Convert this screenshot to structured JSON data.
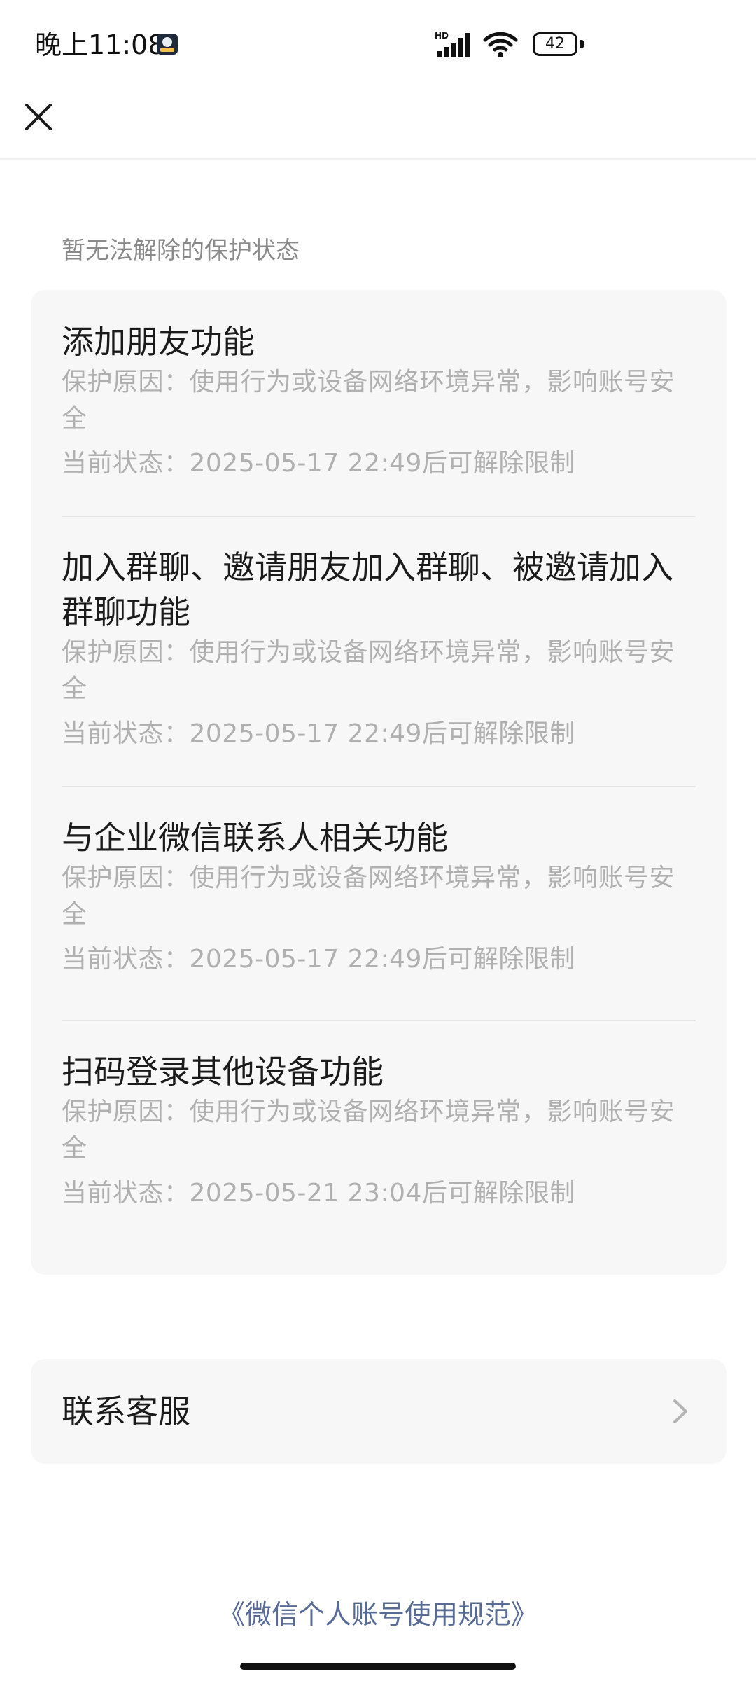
{
  "status_bar": {
    "time": "晚上11:08",
    "network_badge": "HD",
    "battery": "42",
    "battery_level_percent": 42
  },
  "nav": {
    "close_icon": "close-icon"
  },
  "section": {
    "title": "暂无法解除的保护状态"
  },
  "items": [
    {
      "title": "添加朋友功能",
      "reason": "保护原因：使用行为或设备网络环境异常，影响账号安全",
      "status": "当前状态：2025-05-17 22:49后可解除限制"
    },
    {
      "title": "加入群聊、邀请朋友加入群聊、被邀请加入群聊功能",
      "reason": "保护原因：使用行为或设备网络环境异常，影响账号安全",
      "status": "当前状态：2025-05-17 22:49后可解除限制"
    },
    {
      "title": "与企业微信联系人相关功能",
      "reason": "保护原因：使用行为或设备网络环境异常，影响账号安全",
      "status": "当前状态：2025-05-17 22:49后可解除限制"
    },
    {
      "title": "扫码登录其他设备功能",
      "reason": "保护原因：使用行为或设备网络环境异常，影响账号安全",
      "status": "当前状态：2025-05-21 23:04后可解除限制"
    }
  ],
  "contact": {
    "label": "联系客服",
    "icon": "chevron-right-icon"
  },
  "footer": {
    "link": "《微信个人账号使用规范》"
  },
  "colors": {
    "text_primary": "#1b1b1b",
    "text_secondary": "#b0b0b0",
    "card_bg": "#f7f7f7",
    "link": "#576b95"
  }
}
